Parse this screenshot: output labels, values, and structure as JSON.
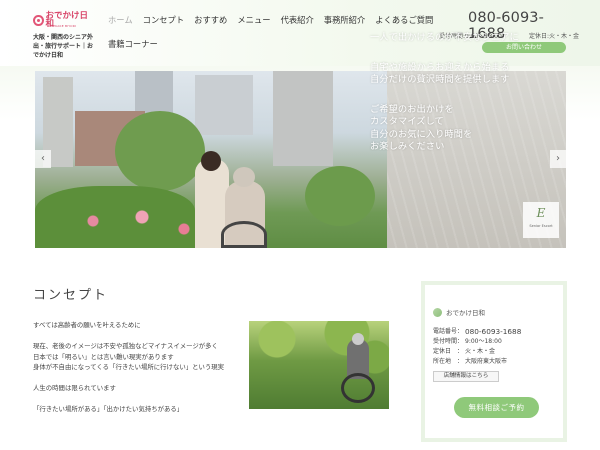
{
  "header": {
    "logo_text": "おでかけ日和",
    "logo_sub": "ODEKAKE BIYORI",
    "tagline": "大阪・関西のシニア外出・旅行サポート｜おでかけ日和",
    "nav": [
      {
        "label": "ホーム",
        "active": true
      },
      {
        "label": "コンセプト"
      },
      {
        "label": "おすすめ"
      },
      {
        "label": "メニュー"
      },
      {
        "label": "代表紹介"
      },
      {
        "label": "事務所紹介"
      },
      {
        "label": "よくあるご質問"
      }
    ],
    "nav_row2": [
      {
        "label": "書籍コーナー"
      }
    ],
    "phone": "080-6093-1688",
    "hours": "受付時間:9:00～18:00",
    "closed": "定休日:火・木・金",
    "contact_button": "お問い合わせ"
  },
  "hero": {
    "lines": [
      "一人で出かけるのが不安なシニアに",
      "自宅や施設からお迎えから始まる",
      "自分だけの贅沢時間を提供します",
      "ご希望のお出かけを",
      "カスタマイズして",
      "自分のお気に入り時間を",
      "お楽しみください"
    ],
    "badge_letter": "E",
    "badge_sub": "Senior Escort",
    "prev": "‹",
    "next": "›"
  },
  "concept": {
    "title": "コンセプト",
    "paragraphs": [
      "すべては高齢者の願いを叶えるために",
      "",
      "現在、老後のイメージは不安や孤独などマイナスイメージが多く",
      "日本では「明るい」とは言い難い現実があります",
      "身体が不自由になってくる「行きたい場所に行けない」という現実",
      "",
      "人生の時間は限られています",
      "",
      "「行きたい場所がある」「出かけたい気持ちがある」"
    ]
  },
  "sidebar": {
    "name": "おでかけ日和",
    "phone_label": "電話番号：",
    "phone": "080-6093-1688",
    "hours_label": "受付時間：",
    "hours": "9:00～18:00",
    "closed_label": "定休日　：",
    "closed": "火・木・金",
    "address_label": "所在地　：",
    "address": "大阪府東大阪市",
    "map_button": "店舗情報はこちら",
    "consult_button": "無料相談ご予約"
  },
  "colors": {
    "accent_green": "#8fc97a",
    "logo_pink": "#d84468"
  }
}
